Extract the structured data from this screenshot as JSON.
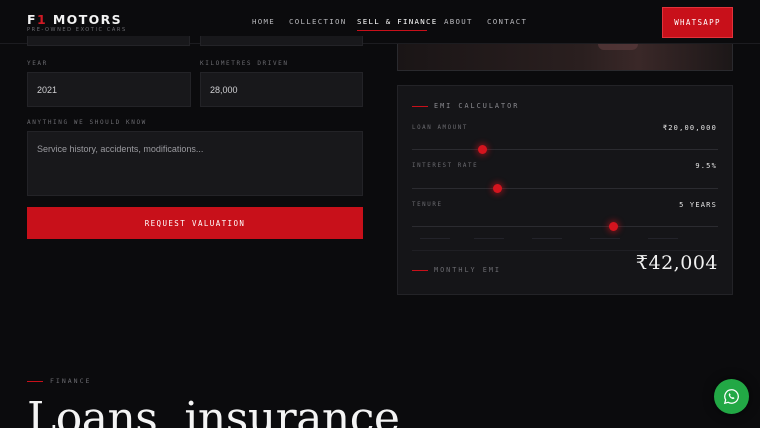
{
  "brand": {
    "name_prefix": "F",
    "name_one": "1",
    "name_suffix": "MOTORS",
    "tagline": "PRE-OWNED EXOTIC CARS"
  },
  "nav": {
    "items": [
      "HOME",
      "COLLECTION",
      "SELL & FINANCE",
      "ABOUT",
      "CONTACT"
    ],
    "active": "SELL & FINANCE"
  },
  "header": {
    "whatsapp_label": "WHATSAPP"
  },
  "form": {
    "year_label": "YEAR",
    "year_value": "2021",
    "km_label": "KILOMETRES DRIVEN",
    "km_value": "28,000",
    "notes_label": "ANYTHING WE SHOULD KNOW",
    "notes_placeholder": "Service history, accidents, modifications...",
    "submit_label": "REQUEST VALUATION"
  },
  "emi": {
    "title": "EMI CALCULATOR",
    "loan_label": "LOAN AMOUNT",
    "loan_value": "₹20,00,000",
    "loan_fraction": 0.23,
    "rate_label": "INTEREST RATE",
    "rate_value": "9.5%",
    "rate_fraction": 0.28,
    "tenure_label": "TENURE",
    "tenure_value": "5 YEARS",
    "tenure_fraction": 0.66,
    "monthly_label": "MONTHLY EMI",
    "monthly_value": "₹42,004"
  },
  "finance": {
    "label": "FINANCE",
    "headline": "Loans, insurance,"
  },
  "colors": {
    "accent": "#c8101a",
    "background": "#0b0b0d",
    "whatsapp_green": "#22a845"
  },
  "icons": {
    "floating": "whatsapp-icon"
  }
}
